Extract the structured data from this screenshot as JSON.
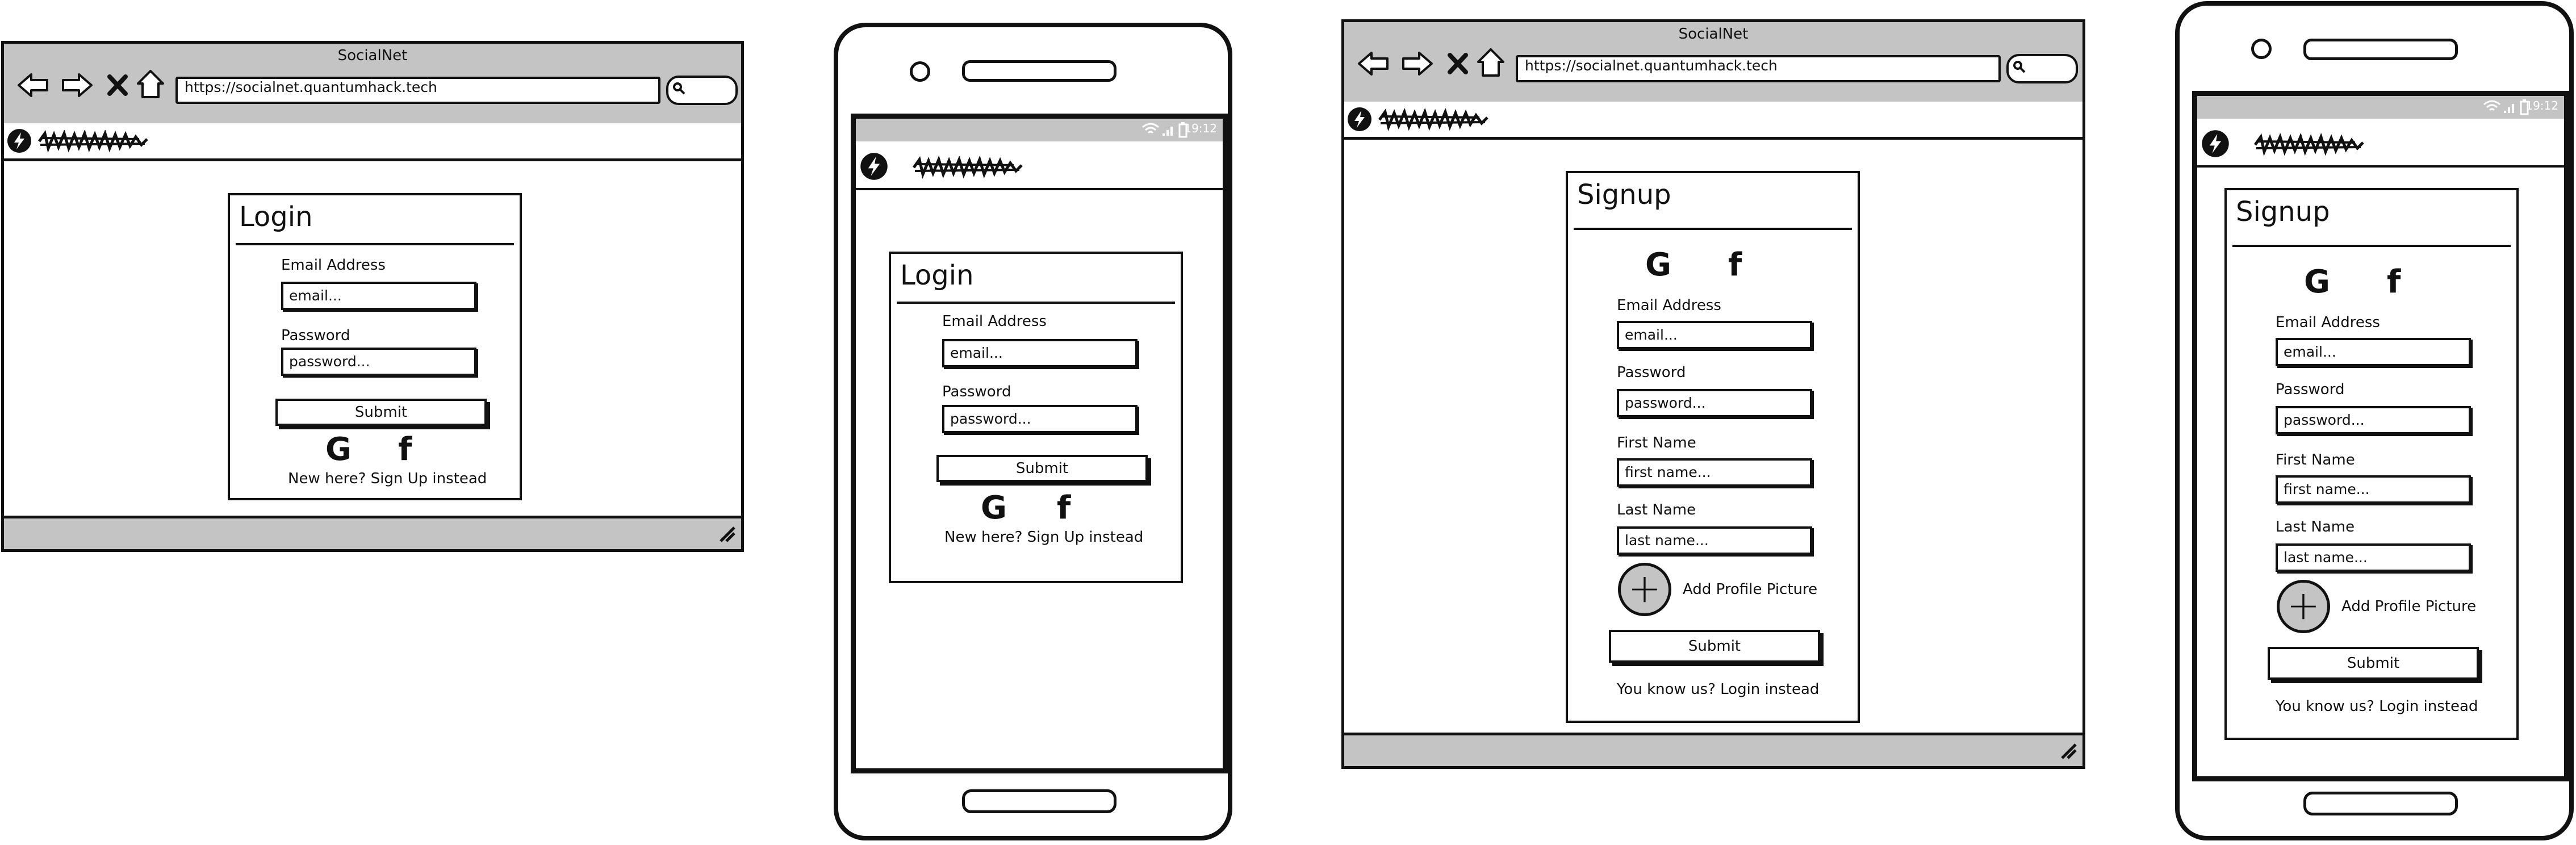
{
  "desktop_login": {
    "window_title": "SocialNet",
    "url": "https://socialnet.quantumhack.tech",
    "card_title": "Login",
    "email_label": "Email Address",
    "email_placeholder": "email...",
    "password_label": "Password",
    "password_placeholder": "password...",
    "submit_label": "Submit",
    "footer_text": "New here? Sign Up instead"
  },
  "mobile_login": {
    "status_time": "19:12",
    "card_title": "Login",
    "email_label": "Email Address",
    "email_placeholder": "email...",
    "password_label": "Password",
    "password_placeholder": "password...",
    "submit_label": "Submit",
    "footer_text": "New here? Sign Up instead"
  },
  "desktop_signup": {
    "window_title": "SocialNet",
    "url": "https://socialnet.quantumhack.tech",
    "card_title": "Signup",
    "email_label": "Email Address",
    "email_placeholder": "email...",
    "password_label": "Password",
    "password_placeholder": "password...",
    "first_name_label": "First Name",
    "first_name_placeholder": "first name...",
    "last_name_label": "Last Name",
    "last_name_placeholder": "last name...",
    "add_picture_label": "Add Profile Picture",
    "submit_label": "Submit",
    "footer_text": "You know us? Login instead"
  },
  "mobile_signup": {
    "status_time": "19:12",
    "card_title": "Signup",
    "email_label": "Email Address",
    "email_placeholder": "email...",
    "password_label": "Password",
    "password_placeholder": "password...",
    "first_name_label": "First Name",
    "first_name_placeholder": "first name...",
    "last_name_label": "Last Name",
    "last_name_placeholder": "last name...",
    "add_picture_label": "Add Profile Picture",
    "submit_label": "Submit",
    "footer_text": "You know us? Login instead"
  },
  "icons": {
    "back": "arrow-left-icon",
    "forward": "arrow-right-icon",
    "stop": "close-icon",
    "home": "home-icon",
    "search": "search-icon",
    "logo": "lightning-bolt-icon",
    "google": "google-icon",
    "facebook": "facebook-icon",
    "add": "plus-icon",
    "resize": "resize-grip-icon",
    "wifi": "wifi-icon",
    "signal": "signal-icon",
    "battery": "battery-icon"
  },
  "colors": {
    "chrome": "#c4c4c4",
    "ink": "#111111",
    "paper": "#ffffff"
  }
}
